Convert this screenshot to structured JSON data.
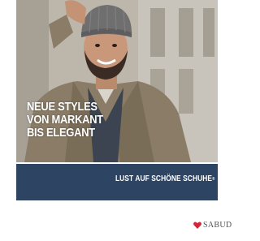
{
  "ad": {
    "headline_lines": [
      "NEUE STYLES",
      "VON MARKANT",
      "BIS ELEGANT"
    ],
    "tagline": "LUST AUF SCHÖNE SCHUHE",
    "tagline_mark": "®",
    "logo_text": "SABUD"
  },
  "colors": {
    "band": "#2d4463",
    "logo_heart": "#d0283a",
    "text_on_band": "#ffffff"
  },
  "icons": {
    "logo": "heart-icon"
  }
}
